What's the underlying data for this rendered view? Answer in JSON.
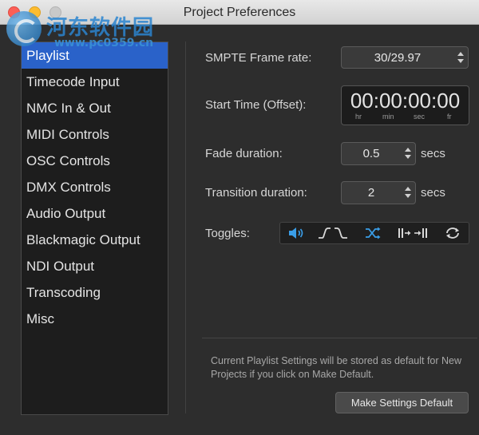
{
  "window": {
    "title": "Project Preferences"
  },
  "watermark": {
    "line1": "河东软件园",
    "line2": "www.pc0359.cn"
  },
  "sidebar": {
    "items": [
      {
        "label": "Playlist",
        "selected": true
      },
      {
        "label": "Timecode Input"
      },
      {
        "label": "NMC In & Out"
      },
      {
        "label": "MIDI Controls"
      },
      {
        "label": "OSC Controls"
      },
      {
        "label": "DMX Controls"
      },
      {
        "label": "Audio Output"
      },
      {
        "label": "Blackmagic Output"
      },
      {
        "label": "NDI Output"
      },
      {
        "label": "Transcoding"
      },
      {
        "label": "Misc"
      }
    ]
  },
  "settings": {
    "smpte_label": "SMPTE Frame rate:",
    "smpte_value": "30/29.97",
    "start_time_label": "Start Time (Offset):",
    "start_time_value": "00:00:00:00",
    "start_time_units": [
      "hr",
      "min",
      "sec",
      "fr"
    ],
    "fade_label": "Fade duration:",
    "fade_value": "0.5",
    "fade_unit": "secs",
    "transition_label": "Transition duration:",
    "transition_value": "2",
    "transition_unit": "secs",
    "toggles_label": "Toggles:",
    "toggles": [
      {
        "icon": "speaker-icon",
        "active": true
      },
      {
        "icon": "fade-curve-icon",
        "active": false
      },
      {
        "icon": "shuffle-icon",
        "active": true
      },
      {
        "icon": "skip-to-next-icon",
        "active": false
      },
      {
        "icon": "loop-icon",
        "active": false
      }
    ]
  },
  "footer": {
    "note": "Current Playlist Settings will be stored as default for New Projects if you click on Make Default.",
    "button_label": "Make Settings Default"
  },
  "colors": {
    "accent": "#2a62c9",
    "toggle_active": "#3a9ee8"
  }
}
